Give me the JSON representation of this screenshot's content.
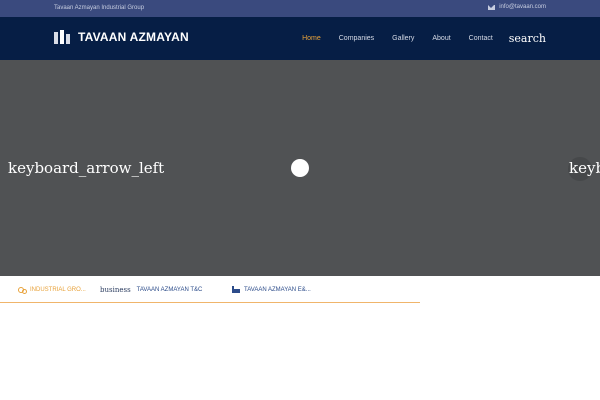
{
  "topbar": {
    "company_group": "Tavaan Azmayan Industrial Group",
    "email": "info@tavaan.com",
    "email_icon": "mail-icon"
  },
  "navbar": {
    "brand": "TAVAAN AZMAYAN",
    "logo_icon": "tavaan-logo",
    "menu": [
      {
        "label": "Home",
        "active": true
      },
      {
        "label": "Companies",
        "active": false
      },
      {
        "label": "Gallery",
        "active": false
      },
      {
        "label": "About",
        "active": false
      },
      {
        "label": "Contact",
        "active": false
      }
    ],
    "search_label": "search"
  },
  "hero": {
    "prev_label": "keyboard_arrow_left",
    "next_label": "keyboard_arrow_right",
    "background": "#505254"
  },
  "tabs": [
    {
      "label": "INDUSTRIAL GRO...",
      "icon": "gears-icon",
      "active": true
    },
    {
      "icon_text": "business",
      "label": "TAVAAN AZMAYAN T&C",
      "active": false
    },
    {
      "label": "TAVAAN AZMAYAN E&...",
      "icon": "industry-icon",
      "active": false
    }
  ],
  "colors": {
    "topbar": "#3a4a7e",
    "navbar": "#061e45",
    "accent": "#e8a23a",
    "link": "#2c4c8a"
  }
}
